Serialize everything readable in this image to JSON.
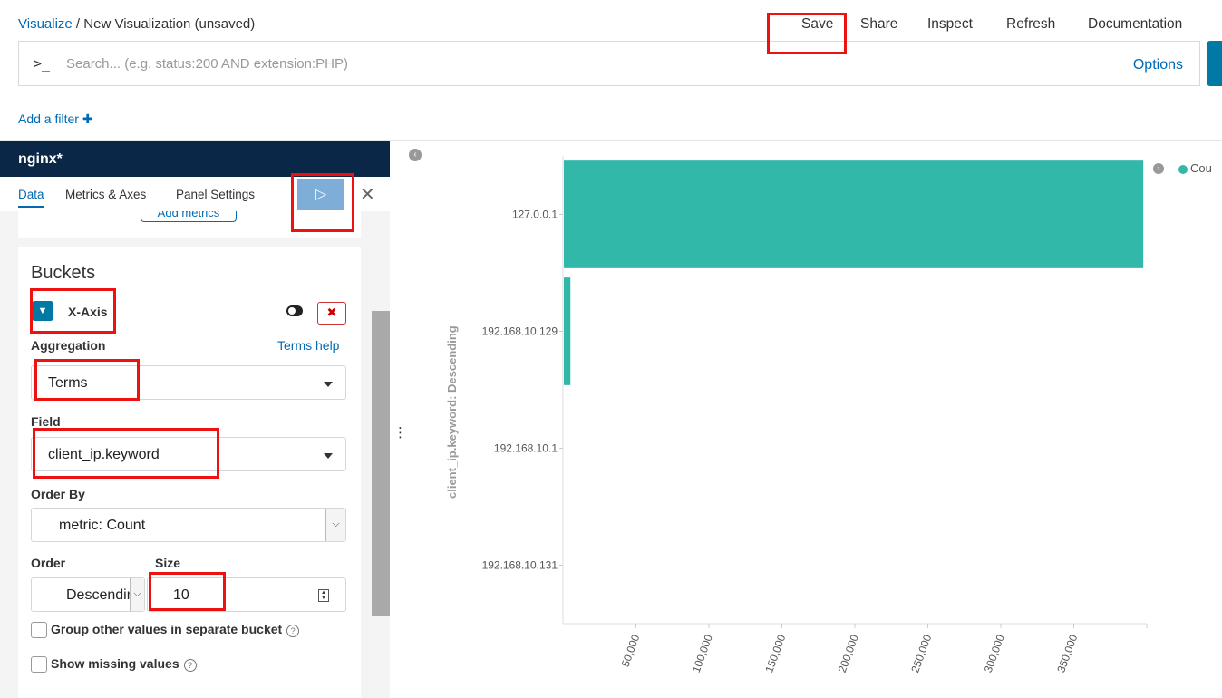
{
  "breadcrumb": {
    "link": "Visualize",
    "separator": " / ",
    "current": "New Visualization (unsaved)"
  },
  "topnav": {
    "save": "Save",
    "share": "Share",
    "inspect": "Inspect",
    "refresh": "Refresh",
    "documentation": "Documentation"
  },
  "query": {
    "prompt": ">_",
    "placeholder": "Search... (e.g. status:200 AND extension:PHP)",
    "options": "Options"
  },
  "filter": {
    "add_label": "Add a filter",
    "add_icon": "plus-icon"
  },
  "sidebar": {
    "index_pattern": "nginx*",
    "tabs": [
      "Data",
      "Metrics & Axes",
      "Panel Settings"
    ],
    "apply_icon": "play-icon",
    "close_icon": "close-icon",
    "add_metrics": "Add metrics",
    "buckets": {
      "title": "Buckets",
      "agg_name": "X-Axis",
      "aggregation_label": "Aggregation",
      "help": "Terms help",
      "aggregation_value": "Terms",
      "field_label": "Field",
      "field_value": "client_ip.keyword",
      "order_by_label": "Order By",
      "order_by_value": "metric: Count",
      "order_label": "Order",
      "order_value": "Descendin",
      "size_label": "Size",
      "size_value": "10",
      "group_other": "Group other values in separate bucket",
      "show_missing": "Show missing values"
    }
  },
  "legend": {
    "label": "Cou",
    "color": "#32b8a9"
  },
  "chart_data": {
    "type": "bar",
    "orientation": "horizontal",
    "ylabel": "client_ip.keyword: Descending",
    "categories": [
      "127.0.0.1",
      "192.168.10.129",
      "192.168.10.1",
      "192.168.10.131"
    ],
    "values": [
      397000,
      4500,
      0,
      0
    ],
    "xticks": [
      "50,000",
      "100,000",
      "150,000",
      "200,000",
      "250,000",
      "300,000",
      "350,000"
    ],
    "xlim": [
      0,
      400000
    ],
    "color": "#32b8a9"
  }
}
